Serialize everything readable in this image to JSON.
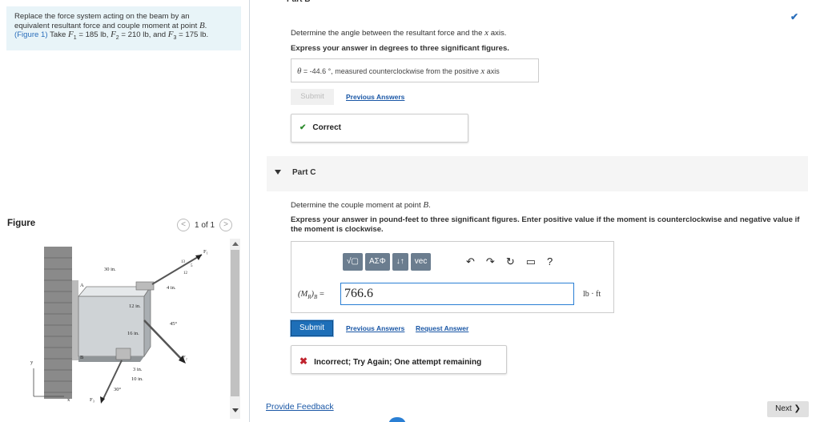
{
  "problem": {
    "line1": "Replace the force system acting on the beam by an",
    "line2_pre": "equivalent resultant force and couple moment at point ",
    "point": "B",
    "line3_ref": "(Figure 1)",
    "line3_take": " Take ",
    "f1": "F",
    "f1_val": " = 185 lb, ",
    "f2_val": " = 210 lb, and ",
    "f3_val": " = 175 lb."
  },
  "figure": {
    "title": "Figure",
    "pager": "1 of 1",
    "prev_icon": "chevron-left",
    "next_icon": "chevron-right",
    "labels": {
      "dim_30": "30 in.",
      "dim_4": "4 in.",
      "dim_12": "12 in.",
      "dim_16": "16 in.",
      "dim_3": "3 in.",
      "dim_10": "10 in.",
      "angle_45": "45°",
      "angle_30": "30°",
      "ratio_13": "13",
      "ratio_12": "12",
      "ratio_5": "5",
      "F1": "F₁",
      "F2": "F₂",
      "F3": "F₃",
      "A": "A",
      "B": "B",
      "x": "x",
      "y": "y"
    }
  },
  "partB": {
    "header": "Part B",
    "question": "Determine the angle between the resultant force and the ",
    "question_axis": "x",
    "question_end": " axis.",
    "instructions": "Express your answer in degrees to three significant figures.",
    "answer_symbol": "θ",
    "answer_text": " = -44.6 °, measured counterclockwise from the positive ",
    "answer_axis": "x",
    "answer_end": " axis",
    "submit_label": "Submit",
    "previous_answers": "Previous Answers",
    "status": "Correct"
  },
  "partC": {
    "header": "Part C",
    "question_pre": "Determine the couple moment at point ",
    "question_point": "B",
    "question_end": ".",
    "instructions": "Express your answer in pound-feet to three significant figures. Enter positive value if the moment is counterclockwise and negative value if the moment is clockwise.",
    "toolbar": {
      "templates": "√▢",
      "greek": "ΑΣΦ",
      "sort": "↓↑",
      "vec": "vec",
      "undo": "↶",
      "redo": "↷",
      "reset": "↻",
      "keyboard": "▭",
      "help": "?"
    },
    "input_label": "(M_R)_B =",
    "input_value": "766.6",
    "units": "lb · ft",
    "submit_label": "Submit",
    "previous_answers": "Previous Answers",
    "request_answer": "Request Answer",
    "status": "Incorrect; Try Again; One attempt remaining"
  },
  "footer": {
    "feedback": "Provide Feedback",
    "next": "Next"
  },
  "colors": {
    "accent": "#1e6fb8",
    "correct": "#2e8b2e",
    "incorrect": "#c0242e",
    "problem_bg": "#e8f4f8"
  }
}
